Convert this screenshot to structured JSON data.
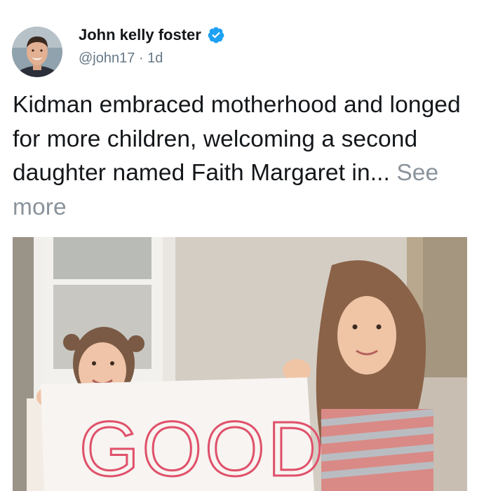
{
  "author": {
    "display_name": "John kelly foster",
    "handle": "@john17",
    "separator": "·",
    "age": "1d",
    "verified": true
  },
  "tweet": {
    "text": "Kidman embraced motherhood and longed for more children, welcoming a second daughter named Faith Margaret in...",
    "see_more_label": "See more"
  },
  "media": {
    "sign_text": "GOOD",
    "sign_color": "#e0506a"
  },
  "colors": {
    "verified": "#1da1f2",
    "muted": "#657786",
    "text": "#14171a"
  }
}
